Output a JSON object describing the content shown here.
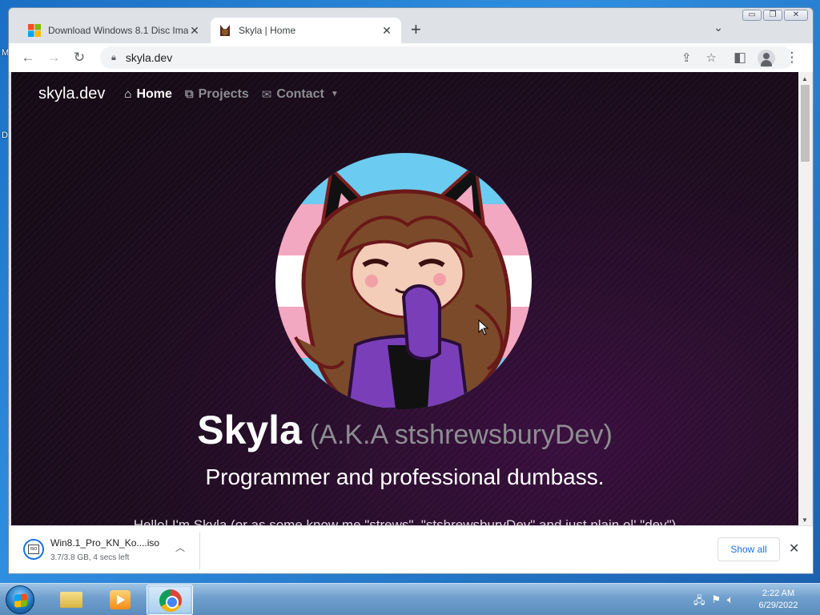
{
  "desktop": {
    "edge_text_1": "M",
    "edge_text_2": "D"
  },
  "browser": {
    "tabs": [
      {
        "title": "Download Windows 8.1 Disc Ima",
        "active": false
      },
      {
        "title": "Skyla | Home",
        "active": true
      }
    ],
    "url": "skyla.dev"
  },
  "site": {
    "brand": "skyla.dev",
    "nav": [
      {
        "label": "Home",
        "icon": "home-icon",
        "active": true
      },
      {
        "label": "Projects",
        "icon": "sitemap-icon",
        "active": false
      },
      {
        "label": "Contact",
        "icon": "envelope-icon",
        "active": false,
        "dropdown": true
      }
    ],
    "name": "Skyla",
    "aka": "(A.K.A stshrewsburyDev)",
    "tagline": "Programmer and professional dumbass.",
    "intro": "Hello! I'm Skyla (or as some know me \"strews\", \"stshrewsburyDev\" and just plain ol' \"dev\")"
  },
  "download": {
    "filename": "Win8.1_Pro_KN_Ko....iso",
    "status": "3.7/3.8 GB, 4 secs left",
    "show_all": "Show all",
    "file_icon_text": "ISO"
  },
  "taskbar": {
    "time": "2:22 AM",
    "date": "6/29/2022"
  }
}
